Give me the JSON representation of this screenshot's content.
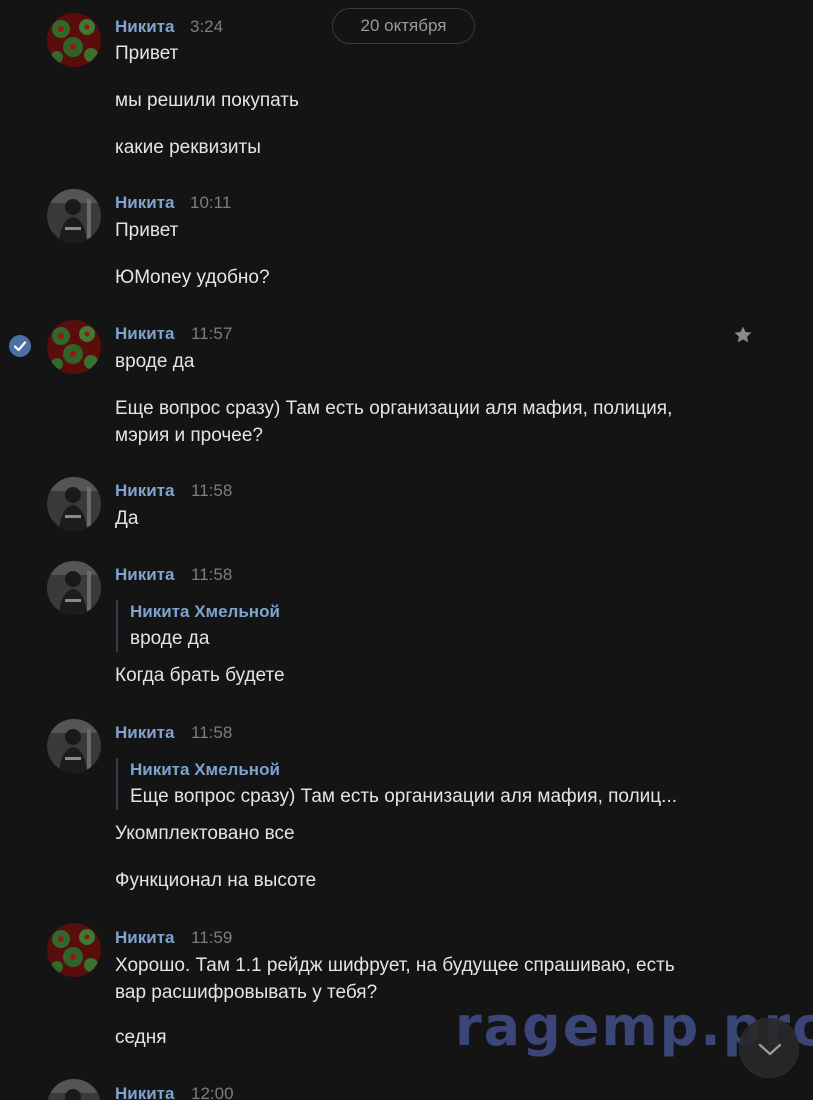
{
  "date_separator": "20 октября",
  "messages": [
    {
      "author": "Никита",
      "time": "3:24",
      "lines": [
        "Привет",
        "мы решили покупать",
        "какие реквизиты"
      ]
    },
    {
      "author": "Никита",
      "time": "10:11",
      "lines": [
        "Привет",
        "ЮMoney удобно?"
      ]
    },
    {
      "author": "Никита",
      "time": "11:57",
      "lines": [
        "вроде да",
        "Еще вопрос сразу) Там есть организации аля мафия, полиция,",
        "мэрия и прочее?"
      ]
    },
    {
      "author": "Никита",
      "time": "11:58",
      "lines": [
        "Да"
      ]
    },
    {
      "author": "Никита",
      "time": "11:58",
      "quote": {
        "author": "Никита Хмельной",
        "text": "вроде да"
      },
      "lines": [
        "Когда брать будете"
      ]
    },
    {
      "author": "Никита",
      "time": "11:58",
      "quote": {
        "author": "Никита Хмельной",
        "text": "Еще вопрос сразу) Там есть организации аля мафия, полиц..."
      },
      "lines": [
        "Укомплектовано все",
        "Функционал на высоте"
      ]
    },
    {
      "author": "Никита",
      "time": "11:59",
      "lines": [
        "Хорошо. Там 1.1 рейдж шифрует, на будущее спрашиваю, есть",
        "вар расшифровывать у тебя?",
        "седня"
      ]
    },
    {
      "author": "Никита",
      "time": "12:00",
      "lines": []
    }
  ],
  "watermark": "ragemp.pro",
  "icons": {
    "selected": "check-circle-icon",
    "favorite": "star-icon",
    "scroll_down": "chevron-down-icon"
  },
  "colors": {
    "background": "#141414",
    "author": "#7fa3cf",
    "text": "#e4e4e4",
    "time": "#7d7d7d",
    "watermark": "#3a4677"
  }
}
